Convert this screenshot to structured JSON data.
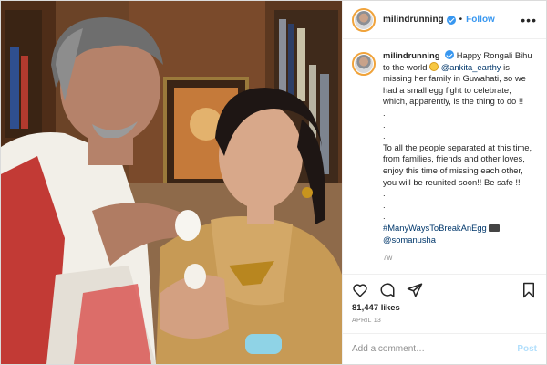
{
  "post": {
    "username": "milindrunning",
    "follow_label": "Follow",
    "separator": "•",
    "more_label": "•••",
    "caption": {
      "p1_text": "Happy Rongali Bihu to the world",
      "p1_mention": "@ankita_earthy",
      "p1_tail": "is missing her family in Guwahati, so we had a small egg fight to celebrate, which, apparently, is the thing to do !!",
      "dots": [
        ".",
        ".",
        "."
      ],
      "p2": "To all the people separated at this time, from families, friends and other loves, enjoy this time of missing each other, you will be reunited soon!! Be safe !!",
      "dots2": [
        ".",
        ".",
        "."
      ],
      "hashtag": "#ManyWaysToBreakAnEgg",
      "mention2": "@somanusha"
    },
    "age": "7w",
    "likes": "81,447 likes",
    "date": "APRIL 13",
    "comment_placeholder": "Add a comment…",
    "post_label": "Post"
  },
  "icons": {
    "verified": "verified-badge-icon",
    "more": "more-options-icon",
    "like": "heart-icon",
    "comment": "comment-icon",
    "share": "share-icon",
    "save": "bookmark-icon"
  },
  "colors": {
    "link": "#00376b",
    "follow": "#3897f0",
    "post_button_disabled": "#b2dffc",
    "muted": "#8e8e8e"
  }
}
